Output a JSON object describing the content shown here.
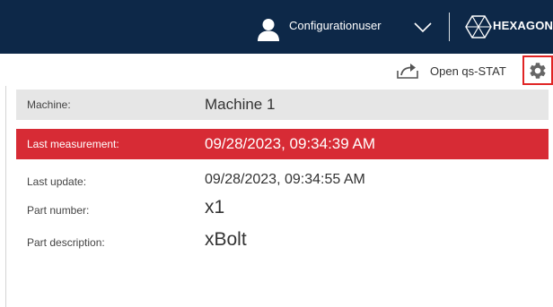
{
  "header": {
    "user_name": "Configurationuser",
    "brand": "HEXAGON"
  },
  "toolbar": {
    "open_label": "Open qs-STAT",
    "settings_icon": "gear-icon"
  },
  "details": [
    {
      "label": "Machine:",
      "value": "Machine 1"
    },
    {
      "label": "Last measurement:",
      "value": "09/28/2023, 09:34:39 AM"
    },
    {
      "label": "Last update:",
      "value": "09/28/2023, 09:34:55 AM"
    },
    {
      "label": "Part number:",
      "value": "x1"
    },
    {
      "label": "Part description:",
      "value": "xBolt"
    }
  ],
  "colors": {
    "header_bg": "#0d2848",
    "highlight_row": "#d72b35",
    "settings_border": "#e02424",
    "machine_row_bg": "#e6e6e6"
  }
}
